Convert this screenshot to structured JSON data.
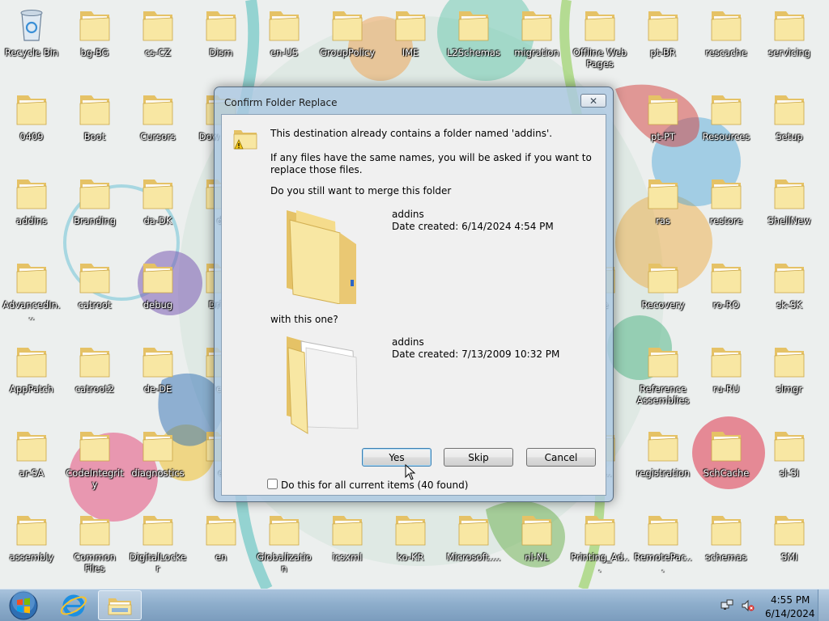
{
  "colors": {
    "folder_light": "#f8e7a3",
    "folder_dark": "#e5c266",
    "dialog_frame": "#acc8e2",
    "taskbar": "#8eaecc"
  },
  "desktop_icons": [
    {
      "label": "Recycle Bin",
      "icon": "recycle-bin-icon"
    },
    {
      "label": "bg-BG",
      "icon": "folder-icon"
    },
    {
      "label": "cs-CZ",
      "icon": "folder-icon"
    },
    {
      "label": "Dism",
      "icon": "folder-icon"
    },
    {
      "label": "en-US",
      "icon": "folder-icon"
    },
    {
      "label": "GroupPolicy",
      "icon": "folder-icon"
    },
    {
      "label": "IME",
      "icon": "folder-icon"
    },
    {
      "label": "L2Schemas",
      "icon": "folder-icon"
    },
    {
      "label": "migration",
      "icon": "folder-icon"
    },
    {
      "label": "Offline Web Pages",
      "icon": "folder-icon"
    },
    {
      "label": "pt-BR",
      "icon": "folder-icon"
    },
    {
      "label": "rescache",
      "icon": "folder-icon"
    },
    {
      "label": "servicing",
      "icon": "folder-icon"
    },
    {
      "label": "0409",
      "icon": "folder-icon"
    },
    {
      "label": "Boot",
      "icon": "folder-icon"
    },
    {
      "label": "Cursors",
      "icon": "folder-icon"
    },
    {
      "label": "Dow Prog",
      "icon": "folder-icon"
    },
    {
      "label": "pt-PT",
      "icon": "folder-icon"
    },
    {
      "label": "Resources",
      "icon": "folder-icon"
    },
    {
      "label": "Setup",
      "icon": "folder-icon"
    },
    {
      "label": "addins",
      "icon": "folder-icon"
    },
    {
      "label": "Branding",
      "icon": "folder-icon"
    },
    {
      "label": "da-DK",
      "icon": "folder-icon"
    },
    {
      "label": "di",
      "icon": "folder-icon"
    },
    {
      "label": "ras",
      "icon": "folder-icon"
    },
    {
      "label": "restore",
      "icon": "folder-icon"
    },
    {
      "label": "ShellNew",
      "icon": "folder-icon"
    },
    {
      "label": "AdvancedIn...",
      "icon": "folder-icon"
    },
    {
      "label": "catroot",
      "icon": "folder-icon"
    },
    {
      "label": "debug",
      "icon": "folder-icon"
    },
    {
      "label": "Drive",
      "icon": "folder-icon"
    },
    {
      "label": "nce",
      "icon": "folder-icon"
    },
    {
      "label": "Recovery",
      "icon": "folder-icon"
    },
    {
      "label": "ro-RO",
      "icon": "folder-icon"
    },
    {
      "label": "sk-SK",
      "icon": "folder-icon"
    },
    {
      "label": "AppPatch",
      "icon": "folder-icon"
    },
    {
      "label": "catroot2",
      "icon": "folder-icon"
    },
    {
      "label": "de-DE",
      "icon": "folder-icon"
    },
    {
      "label": "er",
      "icon": "folder-icon"
    },
    {
      "label": "Reference Assemblies",
      "icon": "folder-icon"
    },
    {
      "label": "ru-RU",
      "icon": "folder-icon"
    },
    {
      "label": "slmgr",
      "icon": "folder-icon"
    },
    {
      "label": "ar-SA",
      "icon": "folder-icon"
    },
    {
      "label": "CodeIntegrity",
      "icon": "folder-icon"
    },
    {
      "label": "diagnostics",
      "icon": "folder-icon"
    },
    {
      "label": "e",
      "icon": "folder-icon"
    },
    {
      "label": "...n...",
      "icon": "folder-icon"
    },
    {
      "label": "registration",
      "icon": "folder-icon"
    },
    {
      "label": "SchCache",
      "icon": "folder-icon"
    },
    {
      "label": "sl-SI",
      "icon": "folder-icon"
    },
    {
      "label": "assembly",
      "icon": "folder-icon"
    },
    {
      "label": "Common Files",
      "icon": "folder-icon"
    },
    {
      "label": "DigitalLocker",
      "icon": "folder-icon"
    },
    {
      "label": "en",
      "icon": "folder-icon"
    },
    {
      "label": "Globalization",
      "icon": "folder-icon"
    },
    {
      "label": "icsxml",
      "icon": "folder-icon"
    },
    {
      "label": "ko-KR",
      "icon": "folder-icon"
    },
    {
      "label": "Microsoft....",
      "icon": "folder-icon"
    },
    {
      "label": "nl-NL",
      "icon": "folder-icon"
    },
    {
      "label": "Printing_Ad...",
      "icon": "folder-icon"
    },
    {
      "label": "RemotePac...",
      "icon": "folder-icon"
    },
    {
      "label": "schemas",
      "icon": "folder-icon"
    },
    {
      "label": "SMI",
      "icon": "folder-icon"
    }
  ],
  "dialog": {
    "title": "Confirm Folder Replace",
    "close_glyph": "✕",
    "message": "This destination already contains a folder named 'addins'.",
    "info": "If any files have the same names, you will be asked if you want to replace those files.",
    "question": "Do you still want to merge this folder",
    "source": {
      "name": "addins",
      "date": "Date created: 6/14/2024 4:54 PM"
    },
    "with_text": "with this one?",
    "dest": {
      "name": "addins",
      "date": "Date created: 7/13/2009 10:32 PM"
    },
    "yes_label": "Yes",
    "skip_label": "Skip",
    "cancel_label": "Cancel",
    "checkbox_label": "Do this for all current items (40 found)",
    "checkbox_checked": false
  },
  "taskbar": {
    "time": "4:55 PM",
    "date": "6/14/2024"
  }
}
